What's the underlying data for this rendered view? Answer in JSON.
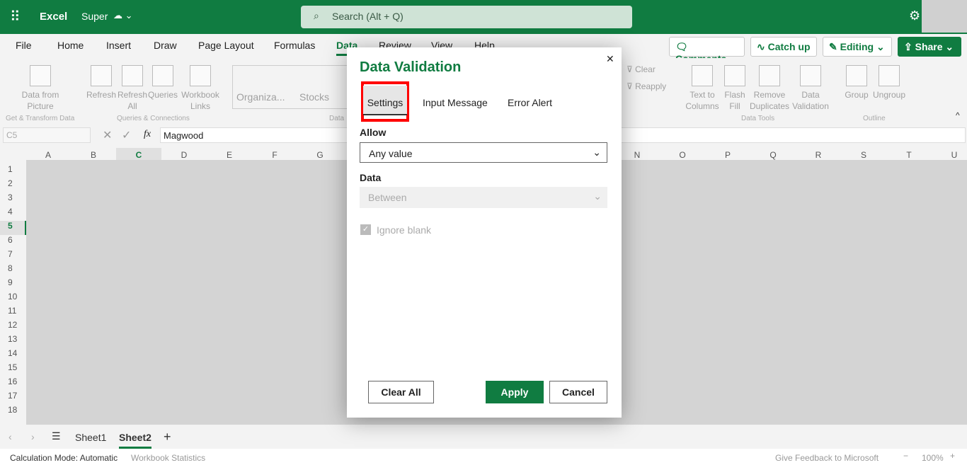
{
  "app": {
    "name": "Excel",
    "file_name": "Super",
    "search_placeholder": "Search (Alt + Q)"
  },
  "menu": [
    "File",
    "Home",
    "Insert",
    "Draw",
    "Page Layout",
    "Formulas",
    "Data",
    "Review",
    "View",
    "Help"
  ],
  "active_menu": "Data",
  "actions": {
    "comments": "Comments",
    "catch_up": "Catch up",
    "editing": "Editing",
    "share": "Share"
  },
  "ribbon": {
    "data_from_picture": "Data from Picture",
    "get_transform": "Get & Transform Data",
    "refresh": "Refresh",
    "refresh_all": "Refresh All",
    "queries": "Queries",
    "workbook_links": "Workbook Links",
    "queries_connections": "Queries & Connections",
    "organiza": "Organiza...",
    "stocks": "Stocks",
    "data_types": "Data",
    "clear": "Clear",
    "reapply": "Reapply",
    "text_to_columns": "Text to Columns",
    "flash_fill": "Flash Fill",
    "remove_duplicates": "Remove Duplicates",
    "data_validation": "Data Validation",
    "data_tools": "Data Tools",
    "group": "Group",
    "ungroup": "Ungroup",
    "outline": "Outline"
  },
  "formula_bar": {
    "name_box": "C5",
    "fx": "fx",
    "value": "Magwood"
  },
  "columns": [
    "A",
    "B",
    "C",
    "D",
    "E",
    "F",
    "G",
    "N",
    "O",
    "P",
    "Q",
    "R",
    "S",
    "T",
    "U"
  ],
  "rows": [
    "1",
    "2",
    "3",
    "4",
    "5",
    "6",
    "7",
    "8",
    "9",
    "10",
    "11",
    "12",
    "13",
    "14",
    "15",
    "16",
    "17",
    "18"
  ],
  "sheets": {
    "items": [
      "Sheet1",
      "Sheet2"
    ],
    "active": "Sheet2"
  },
  "status": {
    "calc_mode": "Calculation Mode: Automatic",
    "workbook_stats": "Workbook Statistics",
    "feedback": "Give Feedback to Microsoft",
    "zoom": "100%"
  },
  "dialog": {
    "title": "Data Validation",
    "tabs": [
      "Settings",
      "Input Message",
      "Error Alert"
    ],
    "active_tab": "Settings",
    "allow_label": "Allow",
    "allow_value": "Any value",
    "data_label": "Data",
    "data_value": "Between",
    "ignore_blank": "Ignore blank",
    "ignore_blank_checked": true,
    "clear_all": "Clear All",
    "apply": "Apply",
    "cancel": "Cancel"
  },
  "colors": {
    "brand": "#107c41",
    "highlight": "#ff0000"
  }
}
